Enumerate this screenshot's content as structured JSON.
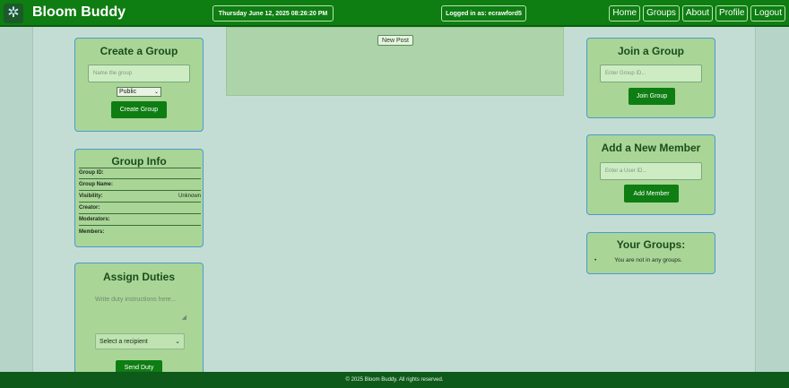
{
  "header": {
    "brand": "Bloom Buddy",
    "datetime": "Thursday June 12, 2025  08:26:20 PM",
    "logged_in": "Logged in as: ecrawford5",
    "nav": [
      "Home",
      "Groups",
      "About",
      "Profile",
      "Logout"
    ]
  },
  "create_group": {
    "title": "Create a Group",
    "name_placeholder": "Name the group",
    "visibility_selected": "Public",
    "button": "Create Group"
  },
  "group_info": {
    "title": "Group Info",
    "rows": [
      {
        "label": "Group ID:",
        "value": ""
      },
      {
        "label": "Group Name:",
        "value": ""
      },
      {
        "label": "Visibility:",
        "value": "Unknown"
      },
      {
        "label": "Creator:",
        "value": ""
      },
      {
        "label": "Moderators:",
        "value": ""
      },
      {
        "label": "Members:",
        "value": ""
      }
    ]
  },
  "assign_duties": {
    "title": "Assign Duties",
    "instructions_placeholder": "Write duty instructions here...",
    "recipient_selected": "Select a recipient",
    "button": "Send Duty"
  },
  "center": {
    "new_post": "New Post"
  },
  "join_group": {
    "title": "Join a Group",
    "placeholder": "Enter Group ID...",
    "button": "Join Group"
  },
  "add_member": {
    "title": "Add a New Member",
    "placeholder": "Enter a User ID...",
    "button": "Add Member"
  },
  "your_groups": {
    "title": "Your Groups:",
    "items": [
      "You are not in any groups."
    ]
  },
  "footer": {
    "text": "© 2025 Bloom Buddy. All rights reserved."
  },
  "colors": {
    "nav_green": "#0e7d12",
    "card_bg": "#a9d597",
    "card_border": "#4a9ad2",
    "page_bg": "#c4ddd4"
  }
}
